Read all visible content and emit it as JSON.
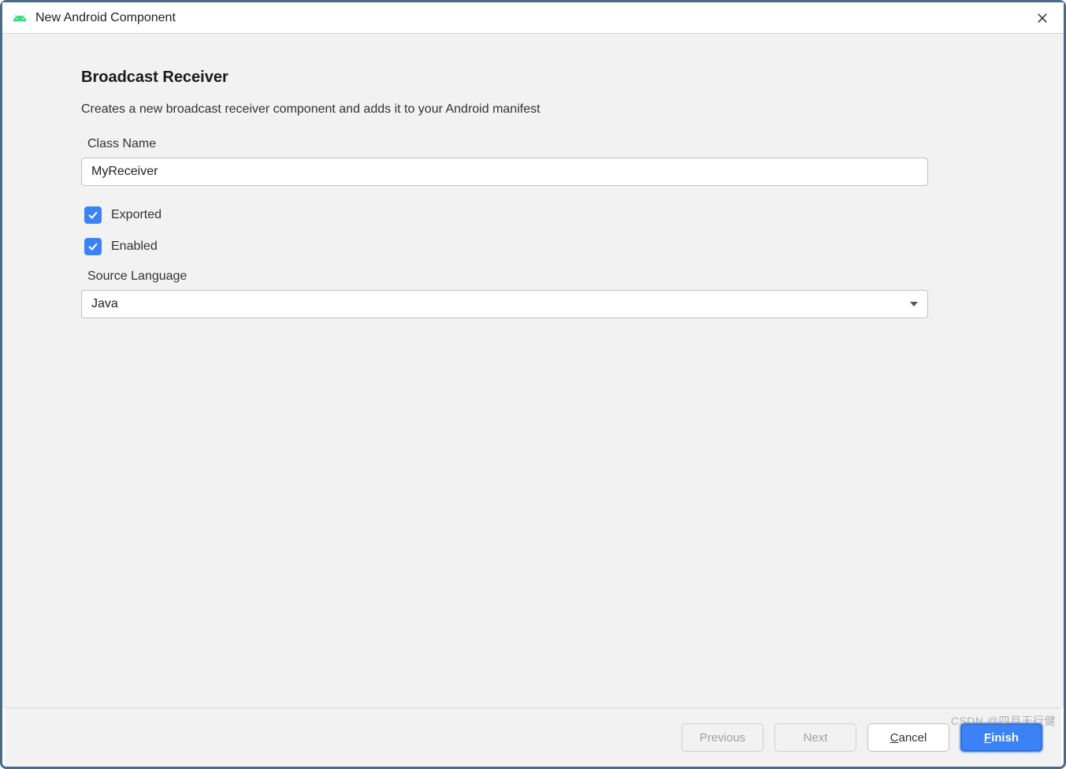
{
  "window": {
    "title": "New Android Component"
  },
  "page": {
    "heading": "Broadcast Receiver",
    "description": "Creates a new broadcast receiver component and adds it to your Android manifest"
  },
  "form": {
    "class_name_label": "Class Name",
    "class_name_value": "MyReceiver",
    "exported_label": "Exported",
    "exported_checked": true,
    "enabled_label": "Enabled",
    "enabled_checked": true,
    "source_language_label": "Source Language",
    "source_language_value": "Java"
  },
  "footer": {
    "previous_label": "Previous",
    "next_label": "Next",
    "cancel_label_prefix": "C",
    "cancel_label_rest": "ancel",
    "finish_label_prefix": "F",
    "finish_label_rest": "inish"
  },
  "watermark": "CSDN @四月天行健"
}
